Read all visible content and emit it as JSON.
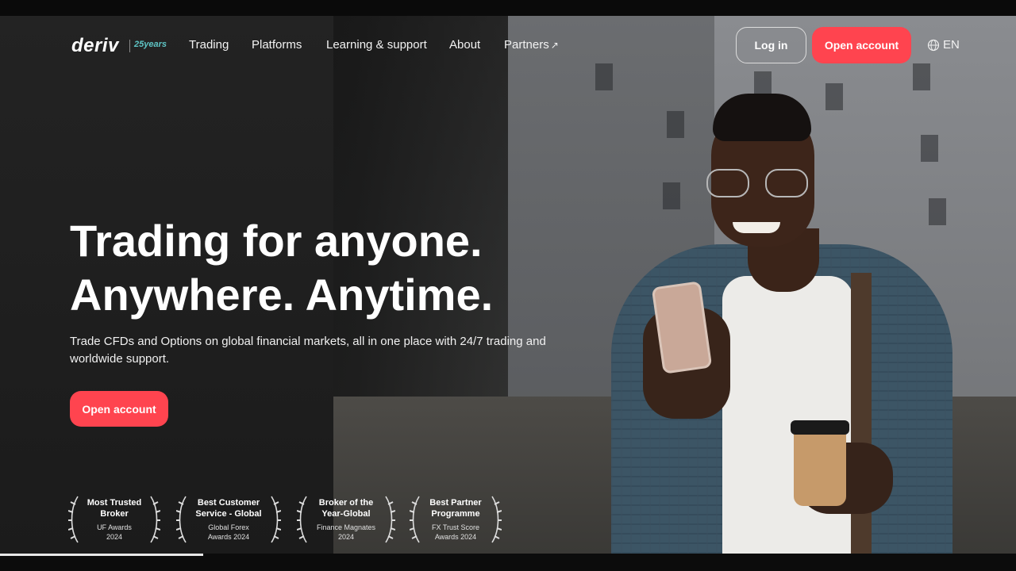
{
  "brand": {
    "logo": "deriv",
    "badge": "25years"
  },
  "nav": {
    "links": [
      "Trading",
      "Platforms",
      "Learning & support",
      "About",
      "Partners"
    ],
    "login": "Log in",
    "open_account": "Open account",
    "language": "EN"
  },
  "hero": {
    "headline_line1": "Trading for anyone.",
    "headline_line2": "Anywhere. Anytime.",
    "subline": "Trade CFDs and Options on global financial markets, all in one place with 24/7 trading and worldwide support.",
    "cta": "Open account"
  },
  "awards": [
    {
      "title_1": "Most Trusted",
      "title_2": "Broker",
      "sub_1": "UF Awards",
      "sub_2": "2024"
    },
    {
      "title_1": "Best Customer",
      "title_2": "Service - Global",
      "sub_1": "Global Forex",
      "sub_2": "Awards 2024"
    },
    {
      "title_1": "Broker of the",
      "title_2": "Year-Global",
      "sub_1": "Finance Magnates",
      "sub_2": "2024"
    },
    {
      "title_1": "Best Partner",
      "title_2": "Programme",
      "sub_1": "FX Trust Score",
      "sub_2": "Awards 2024"
    }
  ],
  "colors": {
    "accent": "#ff444f",
    "badge": "#5ec5c5"
  },
  "video_progress_percent": 20
}
